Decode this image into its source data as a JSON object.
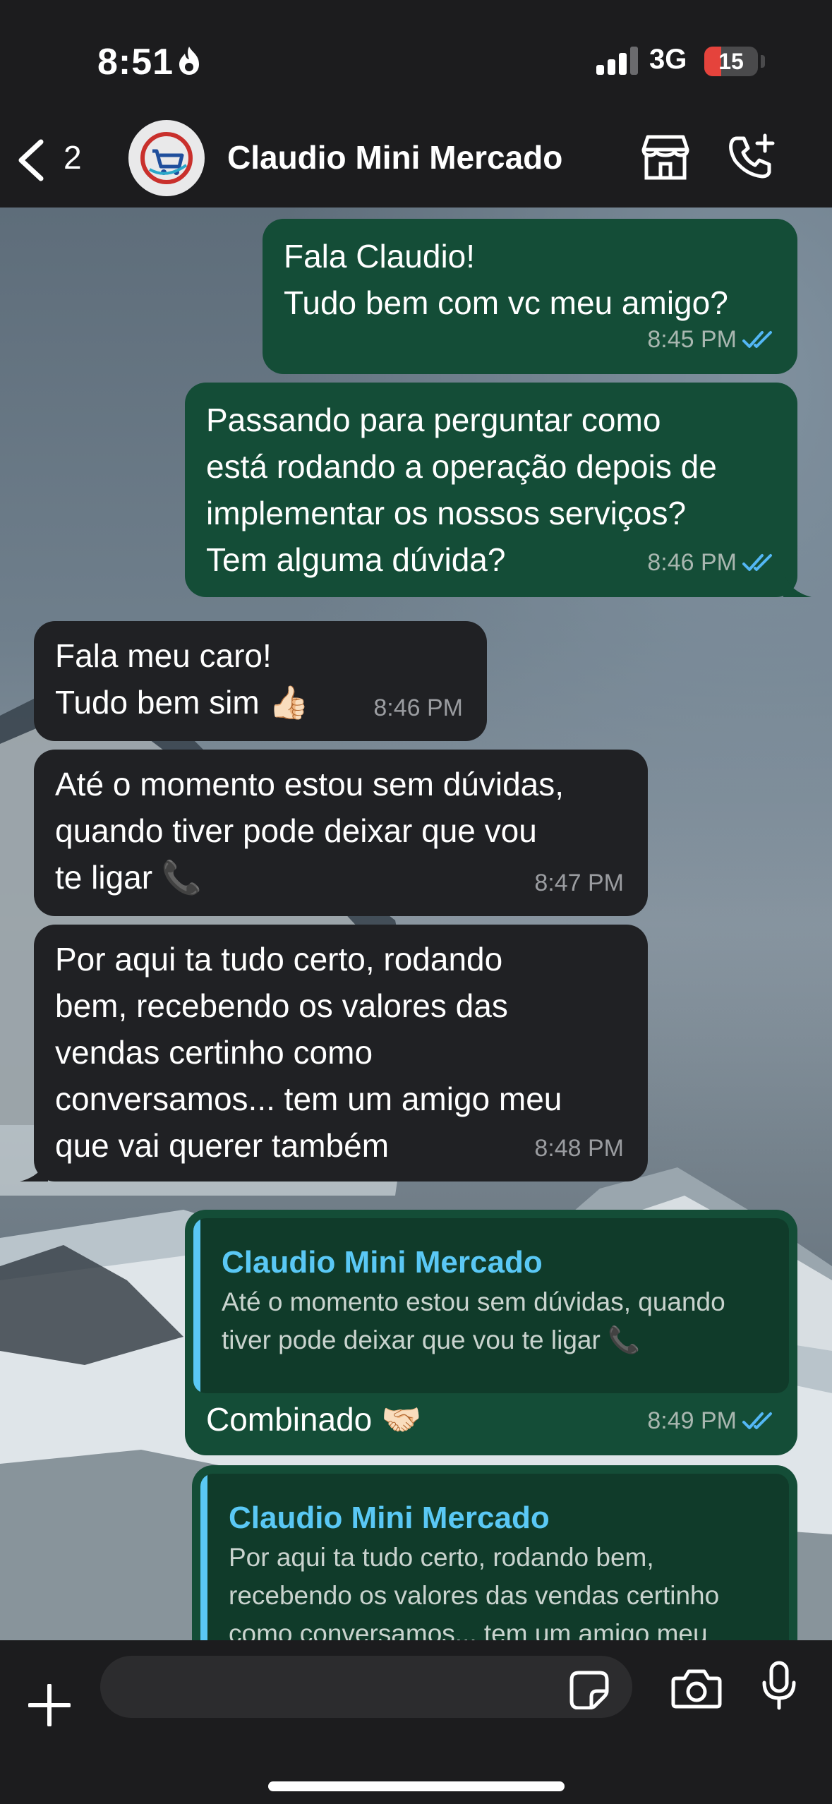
{
  "status_bar": {
    "time": "8:51",
    "network": "3G",
    "battery_level": "15"
  },
  "header": {
    "back_count": "2",
    "contact_name": "Claudio Mini Mercado"
  },
  "messages": [
    {
      "direction": "outgoing",
      "text": "Fala Claudio!\nTudo bem com vc meu amigo?",
      "time": "8:45 PM"
    },
    {
      "direction": "outgoing",
      "text": "Passando para perguntar como\nestá rodando a operação depois de\nimplementar os nossos serviços?\nTem alguma dúvida?",
      "time": "8:46 PM"
    },
    {
      "direction": "incoming",
      "text": "Fala meu caro!\nTudo bem sim 👍🏻",
      "time": "8:46 PM"
    },
    {
      "direction": "incoming",
      "text": "Até o momento estou sem dúvidas,\nquando tiver pode deixar que vou\nte ligar 📞",
      "time": "8:47 PM"
    },
    {
      "direction": "incoming",
      "text": "Por aqui ta tudo certo, rodando\nbem, recebendo os valores das\nvendas certinho como\nconversamos... tem um amigo meu\nque vai querer também",
      "time": "8:48 PM"
    },
    {
      "direction": "outgoing",
      "quote_author": "Claudio Mini Mercado",
      "quote_text": "Até o momento estou sem dúvidas, quando\ntiver pode deixar que vou te ligar 📞",
      "text": "Combinado 🤝🏻",
      "time": "8:49 PM"
    },
    {
      "direction": "outgoing",
      "quote_author": "Claudio Mini Mercado",
      "quote_text": "Por aqui ta tudo certo, rodando bem,\nrecebendo os valores das vendas certinho\ncomo conversamos... tem um amigo meu"
    }
  ],
  "composer": {
    "placeholder": ""
  },
  "colors": {
    "outgoing_bubble": "#144d37",
    "incoming_bubble": "#202124",
    "quote_accent": "#5ac8f5",
    "read_ticks": "#53b7f5"
  }
}
